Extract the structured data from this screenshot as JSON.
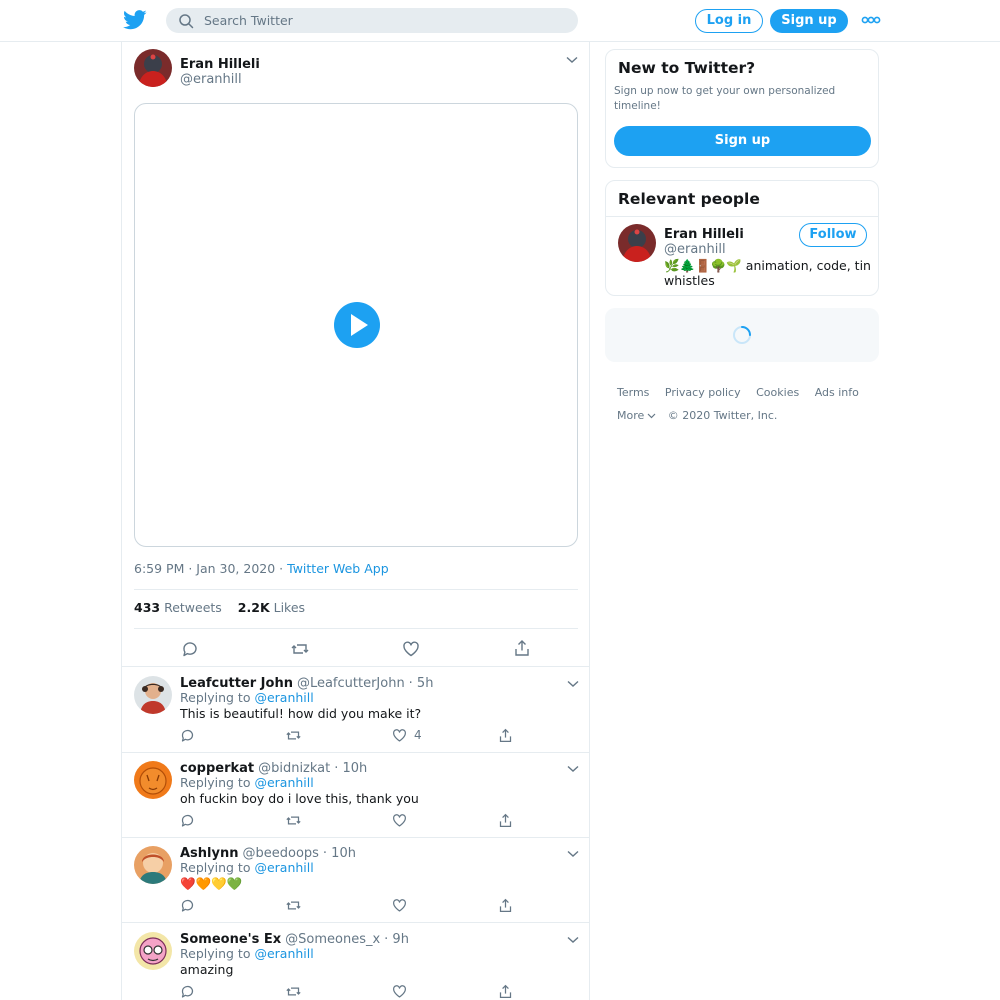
{
  "topbar": {
    "search_placeholder": "Search Twitter",
    "login_label": "Log in",
    "signup_label": "Sign up",
    "icons": [
      "twitter-bird-icon",
      "search-icon",
      "more-dots-icon"
    ]
  },
  "colors": {
    "accent": "#1da1f2",
    "link": "#1b95e0",
    "muted": "#657786",
    "border": "#e6ecf0"
  },
  "tweet": {
    "author_name": "Eran Hilleli",
    "author_handle": "@eranhill",
    "media": "video",
    "time": "6:59 PM · Jan 30, 2020 · ",
    "source": "Twitter Web App",
    "retweets_count": "433",
    "retweets_label": "Retweets",
    "likes_count": "2.2K",
    "likes_label": "Likes"
  },
  "replies": [
    {
      "name": "Leafcutter John",
      "handle": "@LeafcutterJohn",
      "time": "· 5h",
      "replying_label": "Replying to ",
      "replying_to": "@eranhill",
      "text": "This is beautiful! how did you make it?",
      "likes": "4"
    },
    {
      "name": "copperkat",
      "handle": "@bidnizkat",
      "time": "· 10h",
      "replying_label": "Replying to ",
      "replying_to": "@eranhill",
      "text": "oh fuckin boy do i love this, thank you",
      "likes": ""
    },
    {
      "name": "Ashlynn",
      "handle": "@beedoops",
      "time": "· 10h",
      "replying_label": "Replying to ",
      "replying_to": "@eranhill",
      "text": "❤️🧡💛💚",
      "likes": ""
    },
    {
      "name": "Someone's Ex",
      "handle": "@Someones_x",
      "time": "· 9h",
      "replying_label": "Replying to ",
      "replying_to": "@eranhill",
      "text": "amazing",
      "likes": ""
    }
  ],
  "sidebar": {
    "new_title": "New to Twitter?",
    "new_sub": "Sign up now to get your own personalized timeline!",
    "signup_label": "Sign up",
    "relevant_title": "Relevant people",
    "person_name": "Eran Hilleli",
    "person_handle": "@eranhill",
    "follow_label": "Follow",
    "person_bio": "🌿🌲🚪🌳🌱 animation, code, tin whistles"
  },
  "footer": {
    "links": [
      "Terms",
      "Privacy policy",
      "Cookies",
      "Ads info"
    ],
    "more_label": "More",
    "copyright": "© 2020 Twitter, Inc."
  }
}
